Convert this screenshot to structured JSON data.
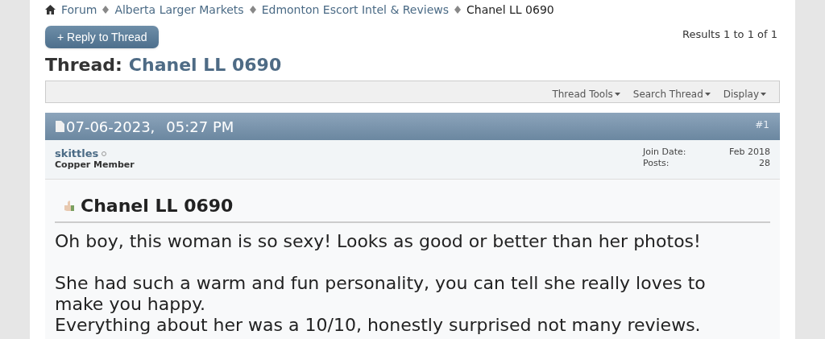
{
  "breadcrumb": [
    "Forum",
    "Alberta Larger Markets",
    "Edmonton Escort Intel & Reviews"
  ],
  "breadcrumb_current": "Chanel LL 0690",
  "reply_button": "+ Reply to Thread",
  "results": "Results 1 to 1 of 1",
  "thread_label": "Thread:",
  "thread_title": "Chanel LL 0690",
  "toolbar": [
    "Thread Tools",
    "Search Thread",
    "Display"
  ],
  "post": {
    "date": "07-06-2023,",
    "time": "05:27 PM",
    "number": "#1",
    "user": {
      "name": "skittles",
      "online": false,
      "rank": "Copper Member"
    },
    "stats": [
      {
        "label": "Join Date:",
        "value": "Feb 2018"
      },
      {
        "label": "Posts:",
        "value": "28"
      }
    ],
    "title": "Chanel LL 0690",
    "paragraphs": [
      [
        "Oh boy, this woman is so sexy! Looks as good or better than her photos!"
      ],
      [
        "She had such a warm and fun personality, you can tell she really loves to make you happy.",
        "Everything about her was a 10/10, honestly surprised not many reviews."
      ]
    ]
  }
}
